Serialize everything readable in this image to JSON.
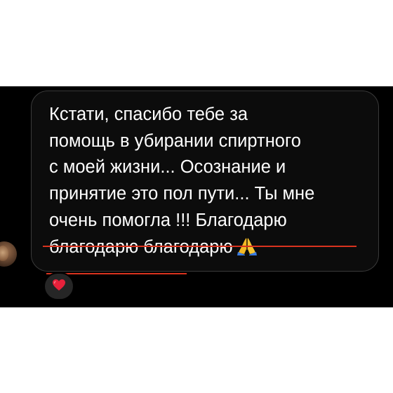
{
  "conversation": {
    "message": {
      "text": "Кстати, спасибо тебе за\nпомощь в убирании спиртного\nс моей жизни... Осознание и\nпринятие это пол пути... Ты мне\nочень помогла !!! Благодарю\nблагодарю благодарю",
      "emoji_icon": "folded-hands-icon",
      "reaction_icon": "red-heart-icon"
    },
    "colors": {
      "background": "#000000",
      "bubble": "#0c0c0c",
      "bubble_border": "#3a3a3a",
      "text": "#ffffff",
      "highlight_underline": "#d9331f",
      "reaction_bg": "#262626",
      "heart": "#e8213b"
    }
  }
}
